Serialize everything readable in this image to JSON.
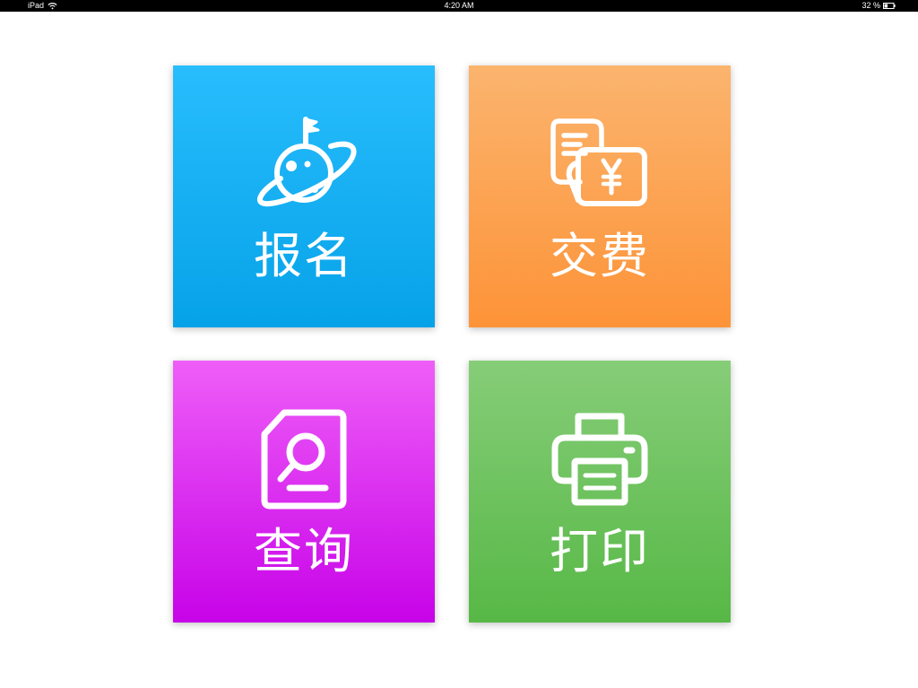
{
  "status_bar": {
    "device": "iPad",
    "time": "4:20 AM",
    "battery": "32 %"
  },
  "tiles": [
    {
      "label": "报名",
      "icon": "planet-flag-icon",
      "color": "#1aafff"
    },
    {
      "label": "交费",
      "icon": "invoice-yen-icon",
      "color": "#fca352"
    },
    {
      "label": "查询",
      "icon": "document-search-icon",
      "color": "#dd2ff0"
    },
    {
      "label": "打印",
      "icon": "printer-icon",
      "color": "#6cc25d"
    }
  ]
}
